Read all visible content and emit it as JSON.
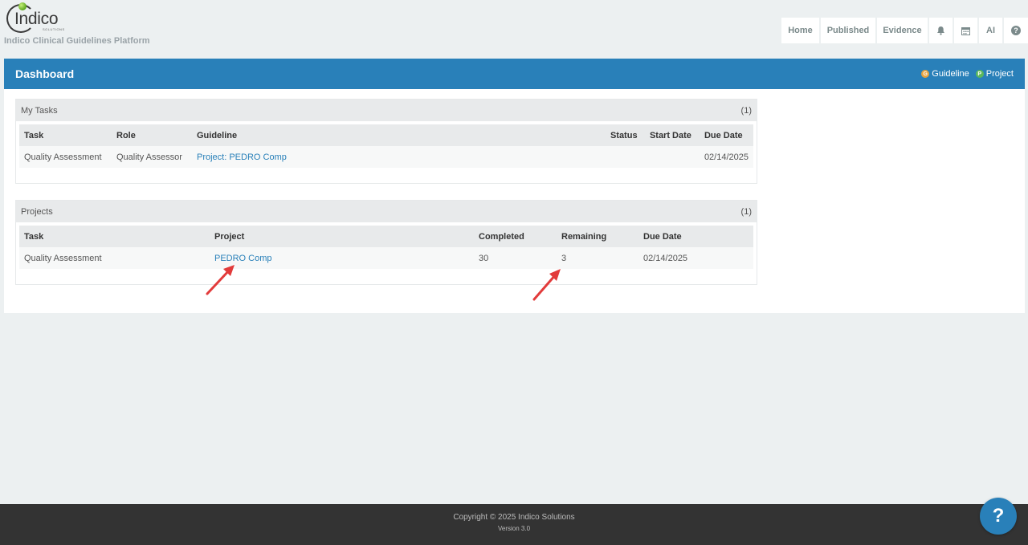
{
  "brand": {
    "logo_text": "Indico",
    "logo_sub": "SOLUTIONS",
    "tagline": "Indico Clinical Guidelines Platform"
  },
  "nav": {
    "home": "Home",
    "published": "Published",
    "evidence": "Evidence",
    "ai": "AI",
    "icons": [
      "bell-icon",
      "calendar-icon",
      "help-circle-icon"
    ]
  },
  "panel": {
    "title": "Dashboard",
    "legend": {
      "guideline_badge": "G",
      "guideline": "Guideline",
      "project_badge": "P",
      "project": "Project"
    }
  },
  "my_tasks": {
    "title": "My Tasks",
    "count": "(1)",
    "columns": [
      "Task",
      "Role",
      "Guideline",
      "Status",
      "Start Date",
      "Due Date"
    ],
    "rows": [
      {
        "task": "Quality Assessment",
        "role": "Quality Assessor",
        "guideline": "Project: PEDRO Comp",
        "status": "",
        "start_date": "",
        "due_date": "02/14/2025"
      }
    ]
  },
  "projects": {
    "title": "Projects",
    "count": "(1)",
    "columns": [
      "Task",
      "Project",
      "Completed",
      "Remaining",
      "Due Date"
    ],
    "rows": [
      {
        "task": "Quality Assessment",
        "project": "PEDRO Comp",
        "completed": "30",
        "remaining": "3",
        "due_date": "02/14/2025"
      }
    ]
  },
  "footer": {
    "copyright": "Copyright © 2025 Indico Solutions",
    "version": "Version 3.0",
    "help": "?"
  },
  "colors": {
    "header_blue": "#2980b9",
    "footer_bg": "#333333",
    "arrow_red": "#e23b3b"
  }
}
